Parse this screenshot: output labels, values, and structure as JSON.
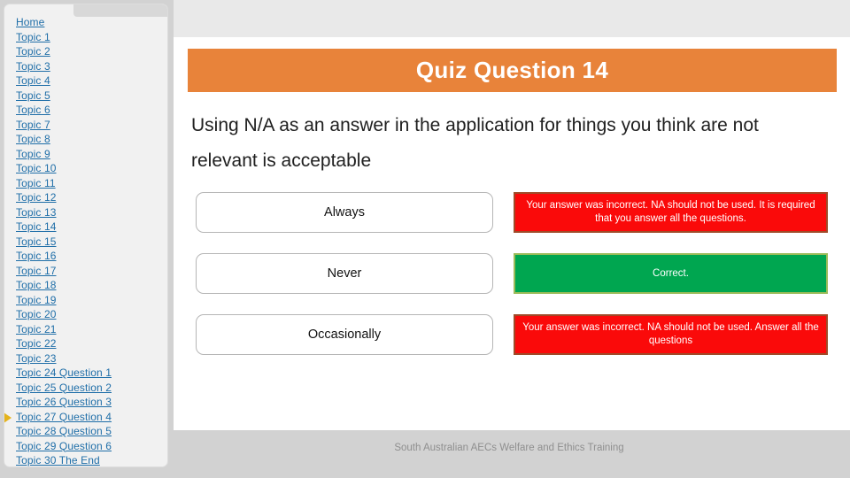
{
  "sidebar": {
    "current_index": 27,
    "items": [
      {
        "label": "Home"
      },
      {
        "label": "Topic 1"
      },
      {
        "label": "Topic 2"
      },
      {
        "label": "Topic 3"
      },
      {
        "label": "Topic 4"
      },
      {
        "label": "Topic 5"
      },
      {
        "label": "Topic 6"
      },
      {
        "label": "Topic 7"
      },
      {
        "label": "Topic 8"
      },
      {
        "label": "Topic 9"
      },
      {
        "label": "Topic 10"
      },
      {
        "label": "Topic 11"
      },
      {
        "label": "Topic 12"
      },
      {
        "label": "Topic 13"
      },
      {
        "label": "Topic 14"
      },
      {
        "label": "Topic 15"
      },
      {
        "label": "Topic 16"
      },
      {
        "label": "Topic 17"
      },
      {
        "label": "Topic 18"
      },
      {
        "label": "Topic 19"
      },
      {
        "label": "Topic 20"
      },
      {
        "label": "Topic 21"
      },
      {
        "label": "Topic 22"
      },
      {
        "label": "Topic 23"
      },
      {
        "label": "Topic 24 Question 1"
      },
      {
        "label": "Topic 25 Question 2"
      },
      {
        "label": "Topic 26 Question 3"
      },
      {
        "label": "Topic 27 Question 4"
      },
      {
        "label": "Topic 28 Question 5"
      },
      {
        "label": "Topic 29 Question 6"
      },
      {
        "label": "Topic 30 The End"
      }
    ]
  },
  "banner": {
    "title": "Quiz Question 14",
    "color": "#e8833a"
  },
  "question": {
    "text": "Using N/A as an answer in the application for things you think are not relevant is acceptable"
  },
  "answers": [
    {
      "option": "Always",
      "feedback": "Your answer was incorrect.  NA should not be used. It is required that you answer all the questions.",
      "state": "incorrect",
      "color": "#fa0a0a"
    },
    {
      "option": "Never",
      "feedback": "Correct.",
      "state": "correct",
      "color": "#00a650"
    },
    {
      "option": "Occasionally",
      "feedback": "Your answer was incorrect. NA should not be used. Answer all the questions",
      "state": "incorrect",
      "color": "#fa0a0a"
    }
  ],
  "footer": {
    "text": "South Australian AECs Welfare and Ethics Training"
  },
  "theme": {
    "link_color": "#1f6ea8",
    "pointer_color": "#e5b31c",
    "page_bg": "#d2d2d2"
  }
}
